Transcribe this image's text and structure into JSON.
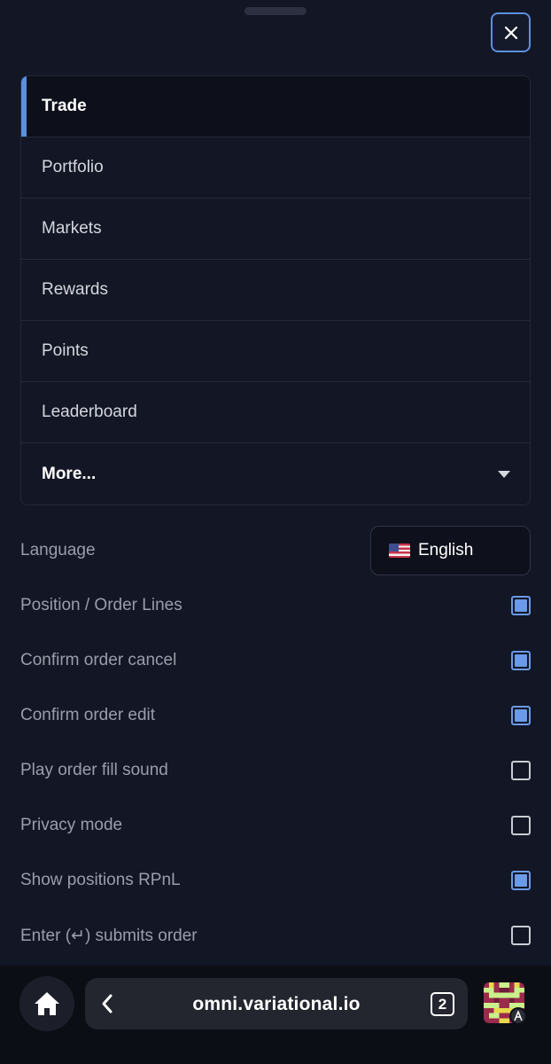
{
  "menu": {
    "items": [
      {
        "label": "Trade",
        "active": true
      },
      {
        "label": "Portfolio"
      },
      {
        "label": "Markets"
      },
      {
        "label": "Rewards"
      },
      {
        "label": "Points"
      },
      {
        "label": "Leaderboard"
      }
    ],
    "more_label": "More..."
  },
  "settings": {
    "language_label": "Language",
    "language_value": "English",
    "language_flag": "us-flag",
    "toggles": [
      {
        "label": "Position / Order Lines",
        "checked": true
      },
      {
        "label": "Confirm order cancel",
        "checked": true
      },
      {
        "label": "Confirm order edit",
        "checked": true
      },
      {
        "label": "Play order fill sound",
        "checked": false
      },
      {
        "label": "Privacy mode",
        "checked": false
      },
      {
        "label": "Show positions RPnL",
        "checked": true
      },
      {
        "label": "Enter (↵) submits order",
        "checked": false
      }
    ]
  },
  "browser": {
    "url": "omni.variational.io",
    "tab_count": "2"
  },
  "colors": {
    "background": "#131624",
    "accent": "#5b8fe0",
    "checkbox_checked": "#6a9ae8"
  }
}
